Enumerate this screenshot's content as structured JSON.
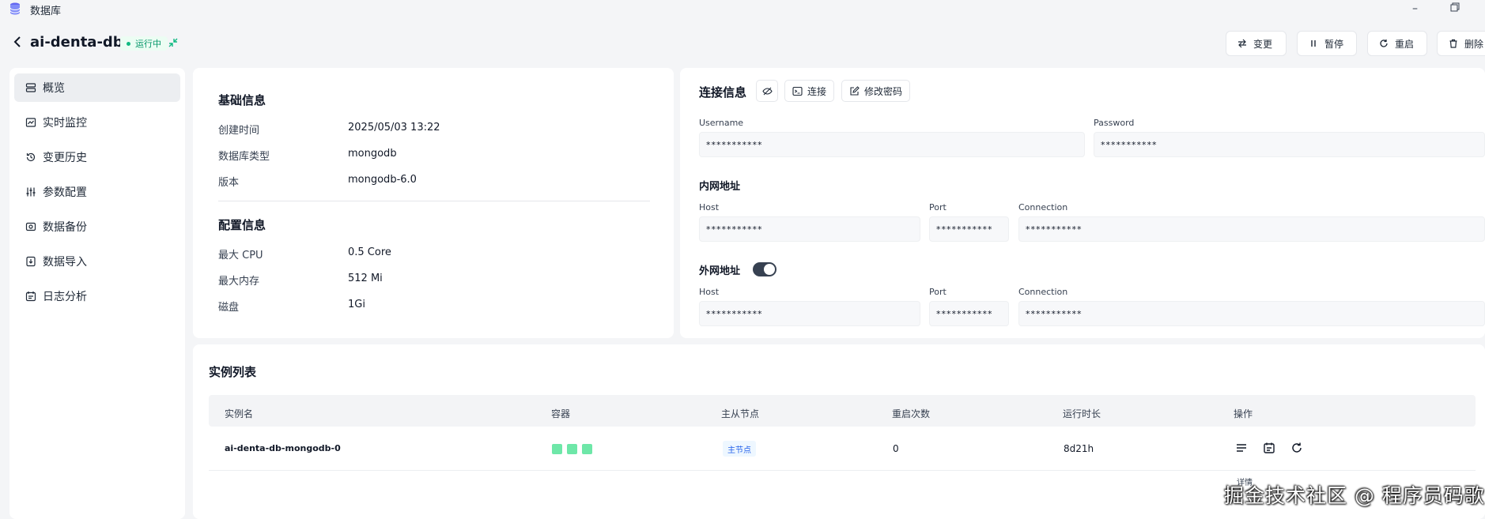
{
  "titlebar": {
    "app_title": "数据库",
    "db_icon": "database-icon",
    "minimize": "–"
  },
  "header": {
    "name": "ai-denta-db",
    "status": "运行中"
  },
  "actions": [
    {
      "label": "变更",
      "icon": "swap-arrows-icon"
    },
    {
      "label": "暂停",
      "icon": "pause-icon"
    },
    {
      "label": "重启",
      "icon": "restart-icon"
    },
    {
      "label": "删除",
      "icon": "trash-icon"
    }
  ],
  "sidebar": {
    "items": [
      {
        "label": "概览",
        "icon": "overview-icon",
        "active": true
      },
      {
        "label": "实时监控",
        "icon": "monitor-chart-icon"
      },
      {
        "label": "变更历史",
        "icon": "history-icon"
      },
      {
        "label": "参数配置",
        "icon": "sliders-icon"
      },
      {
        "label": "数据备份",
        "icon": "backup-icon"
      },
      {
        "label": "数据导入",
        "icon": "import-icon"
      },
      {
        "label": "日志分析",
        "icon": "log-analysis-icon"
      }
    ]
  },
  "basic_info": {
    "title": "基础信息",
    "rows": [
      {
        "label": "创建时间",
        "value": "2025/05/03 13:22"
      },
      {
        "label": "数据库类型",
        "value": "mongodb"
      },
      {
        "label": "版本",
        "value": "mongodb-6.0"
      }
    ]
  },
  "config_info": {
    "title": "配置信息",
    "rows": [
      {
        "label": "最大 CPU",
        "value": "0.5 Core"
      },
      {
        "label": "最大内存",
        "value": "512 Mi"
      },
      {
        "label": "磁盘",
        "value": "1Gi"
      }
    ]
  },
  "connection": {
    "title": "连接信息",
    "connect_label": "连接",
    "change_password_label": "修改密码",
    "username_label": "Username",
    "username_value": "***********",
    "password_label": "Password",
    "password_value": "***********",
    "internal": {
      "title": "内网地址",
      "host_label": "Host",
      "host_value": "***********",
      "port_label": "Port",
      "port_value": "***********",
      "connection_label": "Connection",
      "connection_value": "***********"
    },
    "external": {
      "title": "外网地址",
      "enabled": true,
      "host_label": "Host",
      "host_value": "***********",
      "port_label": "Port",
      "port_value": "***********",
      "connection_label": "Connection",
      "connection_value": "***********"
    }
  },
  "instances": {
    "title": "实例列表",
    "columns": [
      "实例名",
      "容器",
      "主从节点",
      "重启次数",
      "运行时长",
      "操作"
    ],
    "rows": [
      {
        "name": "ai-denta-db-mongodb-0",
        "containers": 3,
        "role": "主节点",
        "restarts": "0",
        "uptime": "8d21h"
      }
    ],
    "tooltip": "详情"
  },
  "watermark": "掘金技术社区 @ 程序员码歌"
}
